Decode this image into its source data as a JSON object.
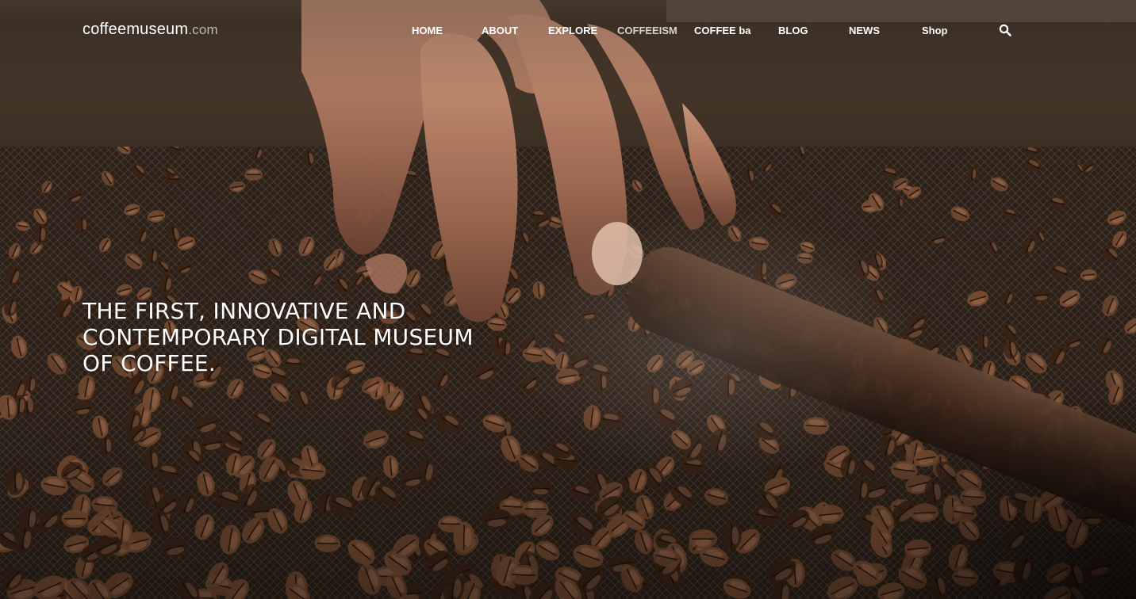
{
  "brand": {
    "name": "coffeemuseum",
    "tld": ".com"
  },
  "nav": {
    "items": [
      {
        "label": "HOME"
      },
      {
        "label": "ABOUT"
      },
      {
        "label": "EXPLORE"
      },
      {
        "label": "COFFEEISM"
      },
      {
        "label": "COFFEE ba"
      },
      {
        "label": "BLOG"
      },
      {
        "label": "NEWS"
      },
      {
        "label": "Shop"
      }
    ],
    "active": "COFFEEISM",
    "search_icon": "search-icon"
  },
  "hero": {
    "headline_lines": [
      "THE FIRST, INNOVATIVE AND",
      "CONTEMPORARY DIGITAL MUSEUM",
      "OF COFFEE."
    ],
    "background_image": "hand sorting roasted coffee beans on a mesh screen"
  },
  "colors": {
    "text": "#ffffff",
    "active_nav": "#d8d3cc",
    "bean_dark": "#3a2417",
    "bean_light": "#7a4e34"
  }
}
